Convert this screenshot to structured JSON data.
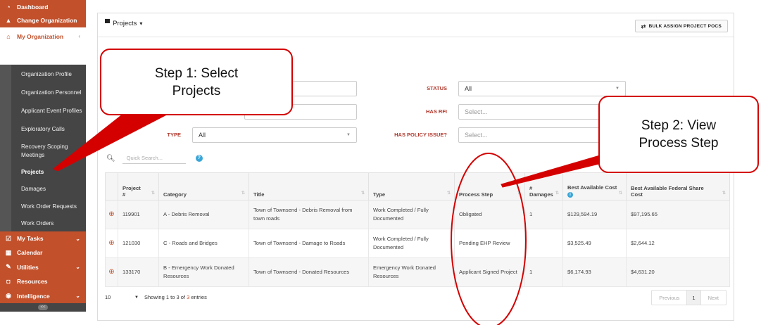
{
  "sidebar": {
    "top_items": [
      {
        "label": "Dashboard",
        "icon": "dashboard-icon"
      },
      {
        "label": "Change Organization",
        "icon": "building-icon"
      }
    ],
    "org": {
      "label": "My Organization",
      "icon": "bank-icon"
    },
    "sub_items": [
      "Organization Profile",
      "Organization Personnel",
      "Applicant Event Profiles",
      "Exploratory Calls",
      "Recovery Scoping Meetings",
      "Projects",
      "Damages",
      "Work Order Requests",
      "Work Orders"
    ],
    "bottom_items": [
      {
        "label": "My Tasks",
        "icon": "check-square-icon"
      },
      {
        "label": "Calendar",
        "icon": "calendar-icon"
      },
      {
        "label": "Utilities",
        "icon": "wrench-icon"
      },
      {
        "label": "Resources",
        "icon": "box-icon"
      },
      {
        "label": "Intelligence",
        "icon": "eye-icon"
      }
    ],
    "collapse": "<<"
  },
  "header": {
    "title": "Projects",
    "bulk_button": "BULK ASSIGN PROJECT POCS"
  },
  "filters": {
    "status_label": "STATUS",
    "status_value": "All",
    "has_rfi_label": "HAS RFI",
    "has_rfi_placeholder": "Select...",
    "type_label": "TYPE",
    "type_value": "All",
    "has_policy_label": "HAS POLICY ISSUE?",
    "has_policy_placeholder": "Select..."
  },
  "search": {
    "placeholder": "Quick Search...",
    "help": "?"
  },
  "table": {
    "headers": {
      "project_line1": "Project",
      "project_line2": "#",
      "category": "Category",
      "title": "Title",
      "type": "Type",
      "process_step": "Process Step",
      "damages_line1": "#",
      "damages_line2": "Damages",
      "best_cost": "Best Available Cost",
      "best_fed_line1": "Best Available Federal Share",
      "best_fed_line2": "Cost"
    },
    "rows": [
      {
        "project": "119901",
        "category": "A - Debris Removal",
        "title": "Town of Townsend - Debris Removal from town roads",
        "type": "Work Completed / Fully Documented",
        "process_step": "Obligated",
        "damages": "1",
        "best_cost": "$129,594.19",
        "best_fed": "$97,195.65"
      },
      {
        "project": "121030",
        "category": "C - Roads and Bridges",
        "title": "Town of Townsend - Damage to Roads",
        "type": "Work Completed / Fully Documented",
        "process_step": "Pending EHP Review",
        "damages": "",
        "best_cost": "$3,525.49",
        "best_fed": "$2,644.12"
      },
      {
        "project": "133170",
        "category": "B - Emergency Work Donated Resources",
        "title": "Town of Townsend - Donated Resources",
        "type": "Emergency Work Donated Resources",
        "process_step": "Applicant Signed Project",
        "damages": "1",
        "best_cost": "$6,174.93",
        "best_fed": "$4,631.20"
      }
    ]
  },
  "footer": {
    "page_length": "10",
    "showing_prefix": "Showing 1 to 3 of",
    "showing_count": "3",
    "showing_suffix": "entries",
    "prev": "Previous",
    "page": "1",
    "next": "Next"
  },
  "callouts": {
    "step1_line1": "Step 1: Select",
    "step1_line2": "Projects",
    "step2_line1": "Step 2: View",
    "step2_line2": "Process Step"
  },
  "colors": {
    "brand": "#c1502b",
    "annotation": "#d40000",
    "sidebar_dark": "#454545"
  }
}
